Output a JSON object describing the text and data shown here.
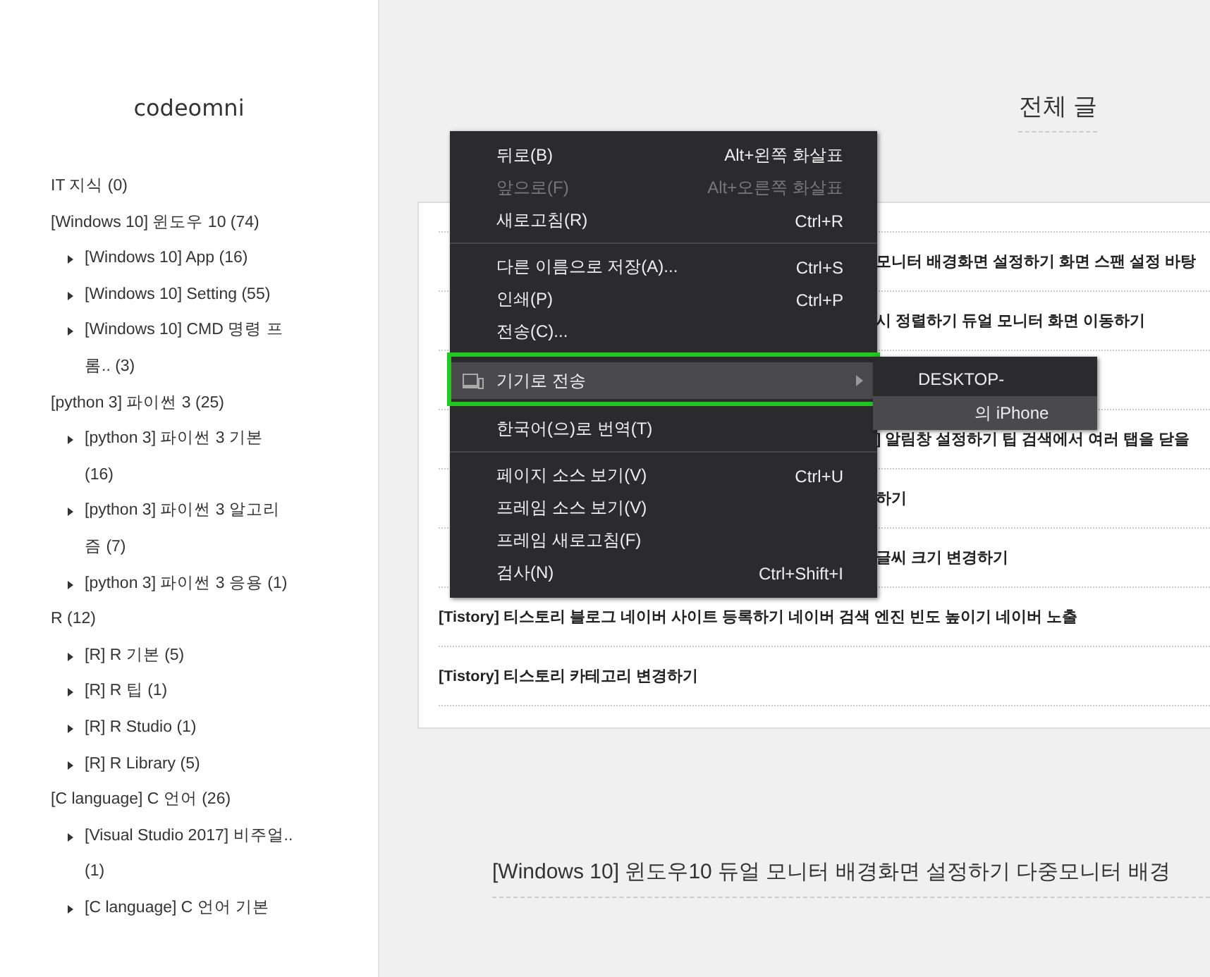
{
  "sidebar": {
    "blog_title": "codeomni",
    "categories": [
      {
        "label": "IT 지식 (0)"
      },
      {
        "label": "[Windows 10] 윈도우 10 (74)",
        "children": [
          {
            "label": "[Windows 10] App (16)"
          },
          {
            "label": "[Windows 10] Setting (55)"
          },
          {
            "label": "[Windows 10] CMD 명령 프롬.. (3)"
          }
        ]
      },
      {
        "label": "[python 3] 파이썬 3 (25)",
        "children": [
          {
            "label": "[python 3] 파이썬 3 기본 (16)"
          },
          {
            "label": "[python 3] 파이썬 3 알고리즘 (7)"
          },
          {
            "label": "[python 3] 파이썬 3 응용 (1)"
          }
        ]
      },
      {
        "label": "R (12)",
        "children": [
          {
            "label": "[R] R 기본 (5)"
          },
          {
            "label": "[R] R 팁 (1)"
          },
          {
            "label": "[R] R Studio (1)"
          },
          {
            "label": "[R] R Library (5)"
          }
        ]
      },
      {
        "label": "[C language] C 언어 (26)",
        "children": [
          {
            "label": "[Visual Studio 2017] 비주얼.. (1)"
          },
          {
            "label": "[C language] C 언어 기본"
          }
        ]
      }
    ]
  },
  "main": {
    "heading": "전체 글",
    "posts": [
      {
        "title": "모니터 배경화면 설정하기 화면 스팬 설정 바탕"
      },
      {
        "title": "시 정렬하기 듀얼 모니터 화면 이동하기"
      },
      {
        "title": "] 알림창 설정하기 팁 검색에서 여러 탭을 닫을"
      },
      {
        "title": "하기"
      },
      {
        "title": "글씨 크기 변경하기"
      },
      {
        "title": "[Tistory] 티스토리 블로그 네이버 사이트 등록하기 네이버 검색 엔진 빈도 높이기 네이버 노출"
      },
      {
        "title": "[Tistory] 티스토리 카테고리 변경하기"
      }
    ],
    "article_title": "[Windows 10] 윈도우10 듀얼 모니터 배경화면 설정하기 다중모니터 배경"
  },
  "context_menu": {
    "items": [
      {
        "kind": "item",
        "label": "뒤로(B)",
        "shortcut": "Alt+왼쪽 화살표",
        "disabled": false,
        "selected": false
      },
      {
        "kind": "item",
        "label": "앞으로(F)",
        "shortcut": "Alt+오른쪽 화살표",
        "disabled": true,
        "selected": false
      },
      {
        "kind": "item",
        "label": "새로고침(R)",
        "shortcut": "Ctrl+R",
        "disabled": false,
        "selected": false
      },
      {
        "kind": "separator"
      },
      {
        "kind": "item",
        "label": "다른 이름으로 저장(A)...",
        "shortcut": "Ctrl+S",
        "disabled": false,
        "selected": false
      },
      {
        "kind": "item",
        "label": "인쇄(P)",
        "shortcut": "Ctrl+P",
        "disabled": false,
        "selected": false
      },
      {
        "kind": "item",
        "label": "전송(C)...",
        "disabled": false,
        "selected": false
      },
      {
        "kind": "separator"
      },
      {
        "kind": "submenu",
        "label": "기기로 전송",
        "disabled": false,
        "selected": true,
        "highlighted_frame": true
      },
      {
        "kind": "separator"
      },
      {
        "kind": "item",
        "label": "한국어(으)로 번역(T)",
        "disabled": false,
        "selected": false
      },
      {
        "kind": "separator"
      },
      {
        "kind": "item",
        "label": "페이지 소스 보기(V)",
        "shortcut": "Ctrl+U",
        "disabled": false,
        "selected": false
      },
      {
        "kind": "item",
        "label": "프레임 소스 보기(V)",
        "disabled": false,
        "selected": false
      },
      {
        "kind": "item",
        "label": "프레임 새로고침(F)",
        "disabled": false,
        "selected": false
      },
      {
        "kind": "item",
        "label": "검사(N)",
        "shortcut": "Ctrl+Shift+I",
        "disabled": false,
        "selected": false
      }
    ],
    "submenu": [
      {
        "label": "DESKTOP-",
        "selected": false
      },
      {
        "label": "의 iPhone",
        "selected": true
      }
    ]
  }
}
